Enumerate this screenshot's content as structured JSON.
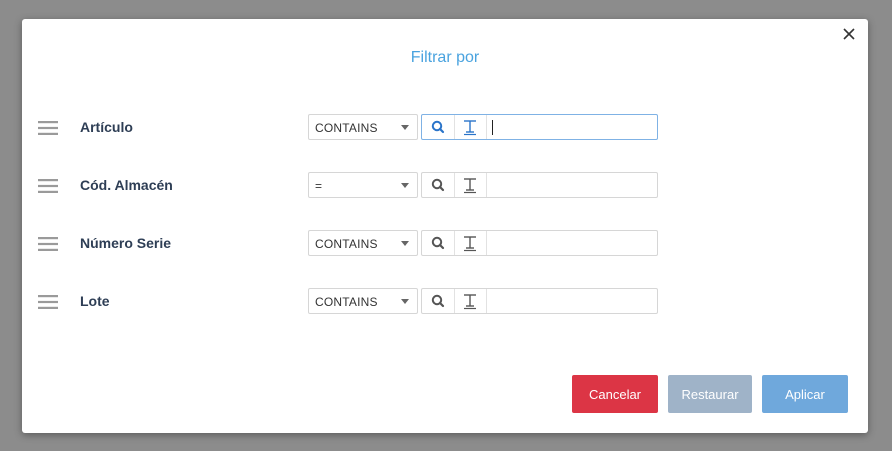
{
  "dialog": {
    "title": "Filtrar por",
    "close_icon": "close-icon"
  },
  "filters": [
    {
      "label": "Artículo",
      "operator": "CONTAINS",
      "value": "",
      "focused": true
    },
    {
      "label": "Cód. Almacén",
      "operator": "=",
      "value": "",
      "focused": false
    },
    {
      "label": "Número Serie",
      "operator": "CONTAINS",
      "value": "",
      "focused": false
    },
    {
      "label": "Lote",
      "operator": "CONTAINS",
      "value": "",
      "focused": false
    }
  ],
  "buttons": {
    "cancel_label": "Cancelar",
    "reset_label": "Restaurar",
    "apply_label": "Aplicar"
  },
  "colors": {
    "title": "#4aa3df",
    "label": "#2e3e55",
    "cancel": "#dc3545",
    "reset": "#9fb3c8",
    "apply": "#6fa8dc",
    "focus_icon": "#2a74c9",
    "icon": "#555555"
  },
  "icons": {
    "drag": "hamburger-icon",
    "search": "search-icon",
    "text": "text-icon",
    "dropdown": "chevron-down-icon"
  }
}
